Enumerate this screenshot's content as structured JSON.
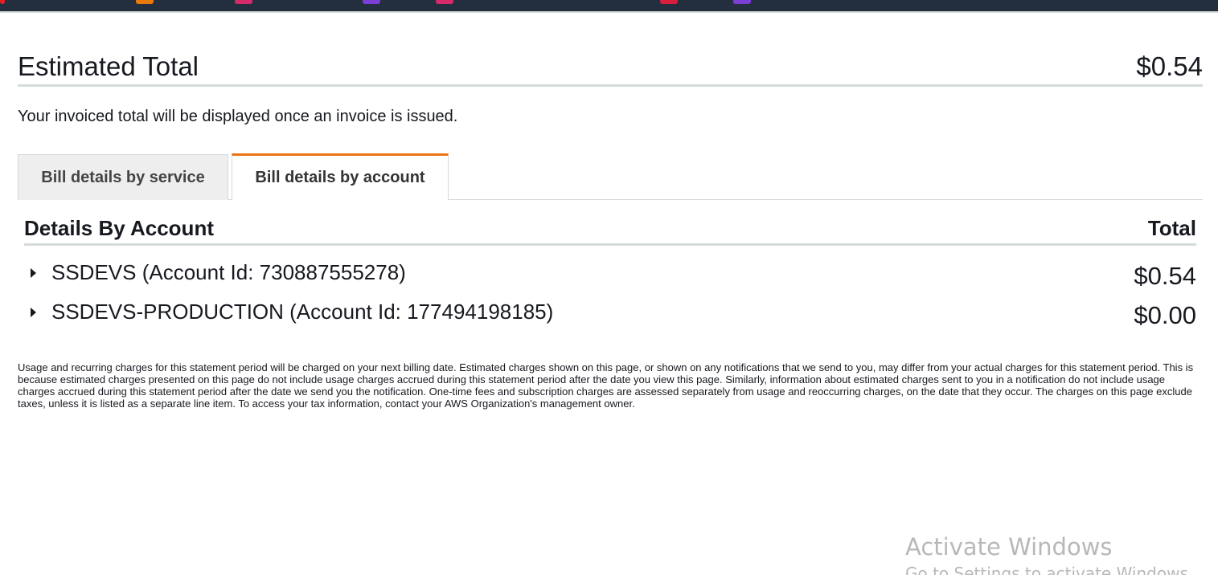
{
  "topbar": {
    "favicon_colors": [
      "#e81d25",
      "#e87a0c",
      "#d62b6a",
      "#7b3fd6",
      "#d62b6a",
      "#d81e3c",
      "#7b3fd6"
    ]
  },
  "summary": {
    "title": "Estimated Total",
    "amount": "$0.54",
    "note": "Your invoiced total will be displayed once an invoice is issued."
  },
  "tabs": [
    {
      "label": "Bill details by service",
      "active": false
    },
    {
      "label": "Bill details by account",
      "active": true
    }
  ],
  "details": {
    "title": "Details By Account",
    "total_label": "Total",
    "accounts": [
      {
        "name": "SSDEVS (Account Id: 730887555278)",
        "amount": "$0.54"
      },
      {
        "name": "SSDEVS-PRODUCTION (Account Id: 177494198185)",
        "amount": "$0.00"
      }
    ]
  },
  "disclaimer": "Usage and recurring charges for this statement period will be charged on your next billing date. Estimated charges shown on this page, or shown on any notifications that we send to you, may differ from your actual charges for this statement period. This is because estimated charges presented on this page do not include usage charges accrued during this statement period after the date you view this page. Similarly, information about estimated charges sent to you in a notification do not include usage charges accrued during this statement period after the date we send you the notification. One-time fees and subscription charges are assessed separately from usage and reoccurring charges, on the date that they occur. The charges on this page exclude taxes, unless it is listed as a separate line item. To access your tax information, contact your AWS Organization's management owner.",
  "watermark": {
    "title": "Activate Windows",
    "subtitle": "Go to Settings to activate Windows."
  },
  "colors": {
    "accent_tab": "#ec7211",
    "topbar": "#232f3e"
  }
}
